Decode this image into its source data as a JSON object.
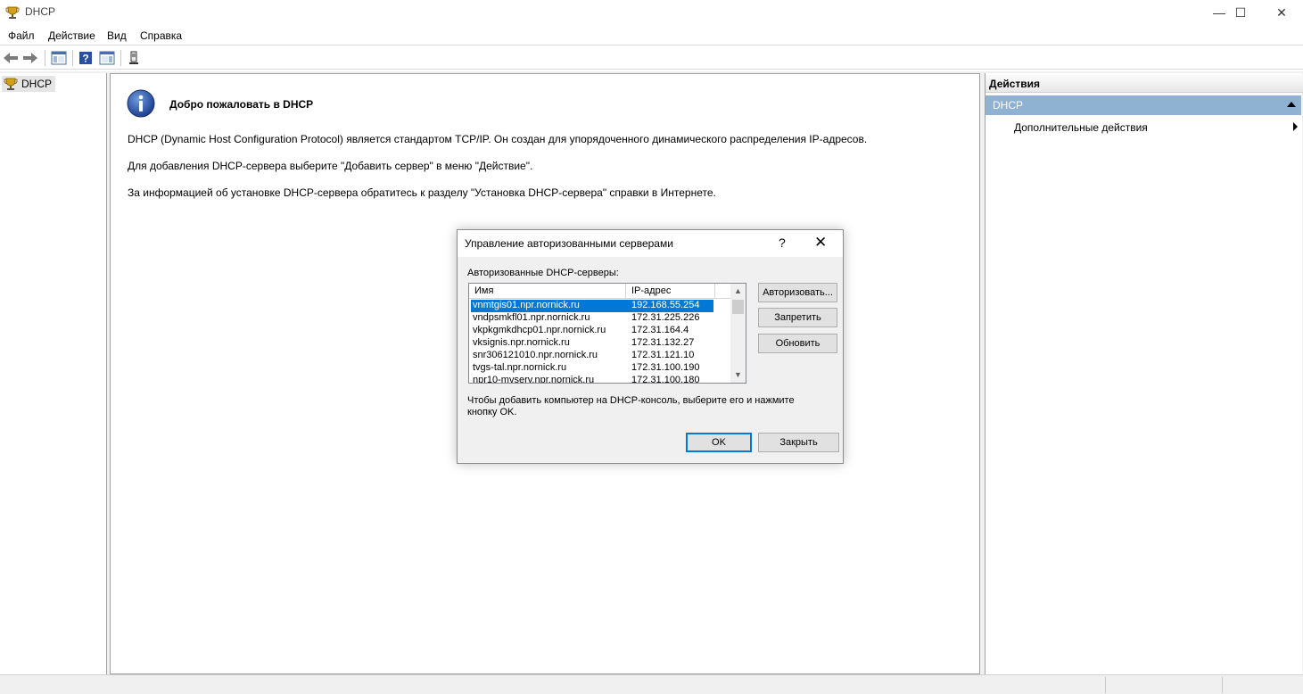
{
  "window": {
    "title": "DHCP",
    "app_icon": "dhcp-trophy-icon",
    "controls": {
      "minimize": "—",
      "maximize": "☐",
      "close": "✕"
    }
  },
  "menu": {
    "file": "Файл",
    "action": "Действие",
    "view": "Вид",
    "help": "Справка"
  },
  "toolbar": {
    "icons": [
      "back-arrow-icon",
      "forward-arrow-icon",
      "show-console-tree-icon",
      "help-icon",
      "action-pane-icon",
      "server-icon"
    ]
  },
  "tree": {
    "root_label": "DHCP"
  },
  "content": {
    "welcome_title": "Добро пожаловать в DHCP",
    "para1": "DHCP (Dynamic Host Configuration Protocol) является стандартом TCP/IP. Он создан для упорядоченного динамического распределения IP-адресов.",
    "para2": "Для добавления DHCP-сервера выберите \"Добавить сервер\" в меню \"Действие\".",
    "para3": "За информацией об установке DHCP-сервера обратитесь к разделу \"Установка DHCP-сервера\" справки в Интернете."
  },
  "actions_pane": {
    "header": "Действия",
    "section": "DHCP",
    "item": "Дополнительные действия",
    "section_color": "#8fb1d2"
  },
  "dialog": {
    "title": "Управление авторизованными серверами",
    "help": "?",
    "close": "✕",
    "list_label": "Авторизованные DHCP-серверы:",
    "columns": {
      "name": "Имя",
      "ip": "IP-адрес"
    },
    "rows": [
      {
        "name": "vnmtgis01.npr.nornick.ru",
        "ip": "192.168.55.254"
      },
      {
        "name": "vndpsmkfl01.npr.nornick.ru",
        "ip": "172.31.225.226"
      },
      {
        "name": "vkpkgmkdhcp01.npr.nornick.ru",
        "ip": "172.31.164.4"
      },
      {
        "name": "vksignis.npr.nornick.ru",
        "ip": "172.31.132.27"
      },
      {
        "name": "snr306121010.npr.nornick.ru",
        "ip": "172.31.121.10"
      },
      {
        "name": "tvgs-tal.npr.nornick.ru",
        "ip": "172.31.100.190"
      },
      {
        "name": "npr10-mvserv.npr.nornick.ru",
        "ip": "172.31.100.180"
      }
    ],
    "selected_index": 0,
    "selection_color": "#0078d7",
    "buttons": {
      "authorize": "Авторизовать...",
      "unauthorize": "Запретить",
      "refresh": "Обновить",
      "ok": "OK",
      "close": "Закрыть"
    },
    "hint": "Чтобы добавить компьютер на DHCP-консоль, выберите его и нажмите кнопку OK."
  }
}
